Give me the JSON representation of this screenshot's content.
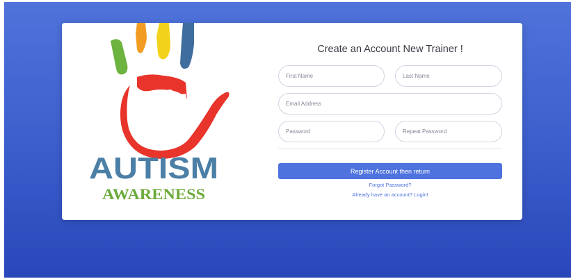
{
  "logo": {
    "title": "AUTISM",
    "subtitle": "AWARENESS",
    "colors": {
      "title": "#4b7fa6",
      "subtitle": "#6aaa3a",
      "hand": "#e8342a",
      "finger_green": "#6db33f",
      "finger_orange": "#f39c22",
      "finger_yellow": "#f3d21b",
      "finger_blue": "#3f6d9e"
    }
  },
  "form": {
    "title": "Create an Account New Trainer !",
    "first_name_placeholder": "First Name",
    "last_name_placeholder": "Last Name",
    "email_placeholder": "Email Address",
    "password_placeholder": "Password",
    "repeat_password_placeholder": "Repeat Password",
    "register_label": "Register Account then return",
    "forgot_label": "Forgot Password?",
    "login_label": "Already have an account? Login!"
  },
  "theme": {
    "background": "#4e73df",
    "accent": "#4e73df"
  }
}
